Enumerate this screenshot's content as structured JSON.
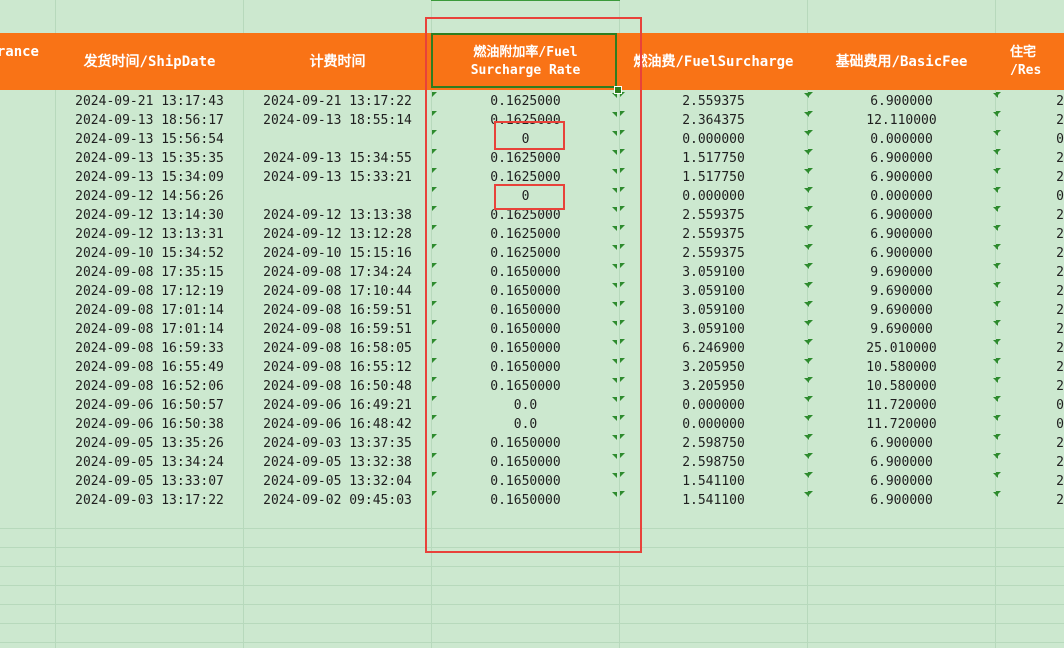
{
  "headers": {
    "left_partial": "rance",
    "ship_date": "发货时间/ShipDate",
    "billing_time": "计费时间",
    "rate_line1": "燃油附加率/Fuel",
    "rate_line2": "Surcharge Rate",
    "fuel_surcharge": "燃油费/FuelSurcharge",
    "basic_fee": "基础费用/BasicFee",
    "right_partial_line1": "住宅",
    "right_partial_line2": "/Res"
  },
  "rows": [
    {
      "ship": "2024-09-21 13:17:43",
      "bill": "2024-09-21 13:17:22",
      "rate": "0.1625000",
      "fuel": "2.559375",
      "basic": "6.900000",
      "last": "2"
    },
    {
      "ship": "2024-09-13 18:56:17",
      "bill": "2024-09-13 18:55:14",
      "rate": "0.1625000",
      "fuel": "2.364375",
      "basic": "12.110000",
      "last": "2"
    },
    {
      "ship": "2024-09-13 15:56:54",
      "bill": "",
      "rate": "0",
      "fuel": "0.000000",
      "basic": "0.000000",
      "last": "0"
    },
    {
      "ship": "2024-09-13 15:35:35",
      "bill": "2024-09-13 15:34:55",
      "rate": "0.1625000",
      "fuel": "1.517750",
      "basic": "6.900000",
      "last": "2"
    },
    {
      "ship": "2024-09-13 15:34:09",
      "bill": "2024-09-13 15:33:21",
      "rate": "0.1625000",
      "fuel": "1.517750",
      "basic": "6.900000",
      "last": "2"
    },
    {
      "ship": "2024-09-12 14:56:26",
      "bill": "",
      "rate": "0",
      "fuel": "0.000000",
      "basic": "0.000000",
      "last": "0"
    },
    {
      "ship": "2024-09-12 13:14:30",
      "bill": "2024-09-12 13:13:38",
      "rate": "0.1625000",
      "fuel": "2.559375",
      "basic": "6.900000",
      "last": "2"
    },
    {
      "ship": "2024-09-12 13:13:31",
      "bill": "2024-09-12 13:12:28",
      "rate": "0.1625000",
      "fuel": "2.559375",
      "basic": "6.900000",
      "last": "2"
    },
    {
      "ship": "2024-09-10 15:34:52",
      "bill": "2024-09-10 15:15:16",
      "rate": "0.1625000",
      "fuel": "2.559375",
      "basic": "6.900000",
      "last": "2"
    },
    {
      "ship": "2024-09-08 17:35:15",
      "bill": "2024-09-08 17:34:24",
      "rate": "0.1650000",
      "fuel": "3.059100",
      "basic": "9.690000",
      "last": "2"
    },
    {
      "ship": "2024-09-08 17:12:19",
      "bill": "2024-09-08 17:10:44",
      "rate": "0.1650000",
      "fuel": "3.059100",
      "basic": "9.690000",
      "last": "2"
    },
    {
      "ship": "2024-09-08 17:01:14",
      "bill": "2024-09-08 16:59:51",
      "rate": "0.1650000",
      "fuel": "3.059100",
      "basic": "9.690000",
      "last": "2"
    },
    {
      "ship": "2024-09-08 17:01:14",
      "bill": "2024-09-08 16:59:51",
      "rate": "0.1650000",
      "fuel": "3.059100",
      "basic": "9.690000",
      "last": "2"
    },
    {
      "ship": "2024-09-08 16:59:33",
      "bill": "2024-09-08 16:58:05",
      "rate": "0.1650000",
      "fuel": "6.246900",
      "basic": "25.010000",
      "last": "2"
    },
    {
      "ship": "2024-09-08 16:55:49",
      "bill": "2024-09-08 16:55:12",
      "rate": "0.1650000",
      "fuel": "3.205950",
      "basic": "10.580000",
      "last": "2"
    },
    {
      "ship": "2024-09-08 16:52:06",
      "bill": "2024-09-08 16:50:48",
      "rate": "0.1650000",
      "fuel": "3.205950",
      "basic": "10.580000",
      "last": "2"
    },
    {
      "ship": "2024-09-06 16:50:57",
      "bill": "2024-09-06 16:49:21",
      "rate": "0.0",
      "fuel": "0.000000",
      "basic": "11.720000",
      "last": "0"
    },
    {
      "ship": "2024-09-06 16:50:38",
      "bill": "2024-09-06 16:48:42",
      "rate": "0.0",
      "fuel": "0.000000",
      "basic": "11.720000",
      "last": "0"
    },
    {
      "ship": "2024-09-05 13:35:26",
      "bill": "2024-09-03 13:37:35",
      "rate": "0.1650000",
      "fuel": "2.598750",
      "basic": "6.900000",
      "last": "2"
    },
    {
      "ship": "2024-09-05 13:34:24",
      "bill": "2024-09-05 13:32:38",
      "rate": "0.1650000",
      "fuel": "2.598750",
      "basic": "6.900000",
      "last": "2"
    },
    {
      "ship": "2024-09-05 13:33:07",
      "bill": "2024-09-05 13:32:04",
      "rate": "0.1650000",
      "fuel": "1.541100",
      "basic": "6.900000",
      "last": "2"
    },
    {
      "ship": "2024-09-03 13:17:22",
      "bill": "2024-09-02 09:45:03",
      "rate": "0.1650000",
      "fuel": "1.541100",
      "basic": "6.900000",
      "last": "2"
    }
  ],
  "colors": {
    "sheet_background": "#cce8cf",
    "header_background": "#f97316",
    "header_text": "#ffffff",
    "selection_border": "#2f7d20",
    "annotation_red": "#e8423a"
  }
}
